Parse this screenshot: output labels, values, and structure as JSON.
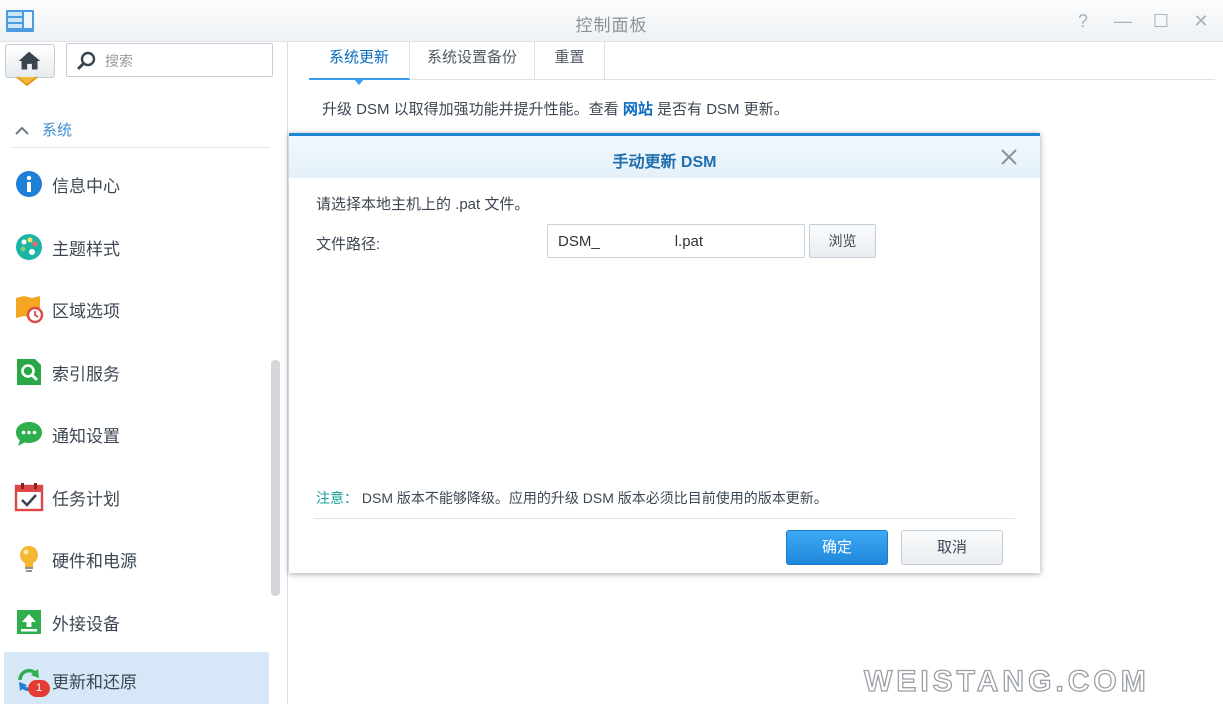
{
  "window": {
    "title": "控制面板",
    "help_label": "?",
    "minimize_label": "—",
    "maximize_label": "☐",
    "close_label": "✕"
  },
  "sidebar": {
    "search_placeholder": "搜索",
    "section_label": "系统",
    "items": [
      {
        "label": "信息中心",
        "icon": "info-icon"
      },
      {
        "label": "主题样式",
        "icon": "palette-icon"
      },
      {
        "label": "区域选项",
        "icon": "region-clock-icon"
      },
      {
        "label": "索引服务",
        "icon": "index-search-icon"
      },
      {
        "label": "通知设置",
        "icon": "chat-bubble-icon"
      },
      {
        "label": "任务计划",
        "icon": "calendar-check-icon"
      },
      {
        "label": "硬件和电源",
        "icon": "lightbulb-icon"
      },
      {
        "label": "外接设备",
        "icon": "external-device-icon"
      },
      {
        "label": "更新和还原",
        "icon": "update-restore-icon",
        "active": true,
        "badge": "1"
      }
    ]
  },
  "main": {
    "tabs": [
      {
        "label": "系统更新",
        "active": true
      },
      {
        "label": "系统设置备份"
      },
      {
        "label": "重置"
      }
    ],
    "description_prefix": "升级 DSM 以取得加强功能并提升性能。查看",
    "description_link": "网站",
    "description_suffix": "是否有 DSM 更新。"
  },
  "dialog": {
    "title": "手动更新 DSM",
    "prompt": "请选择本地主机上的 .pat 文件。",
    "path_label": "文件路径:",
    "path_value": "DSM_                  l.pat",
    "browse_label": "浏览",
    "note_prefix": "注意：",
    "note_text": "DSM 版本不能够降级。应用的升级 DSM 版本必须比目前使用的版本更新。",
    "ok_label": "确定",
    "cancel_label": "取消"
  },
  "watermark": "WEISTANG.COM",
  "colors": {
    "accent": "#1f86d2",
    "link": "#0a6bbf",
    "note": "#1a9f9c",
    "active_item_bg": "#d6e8f8",
    "badge": "#e53b35"
  }
}
